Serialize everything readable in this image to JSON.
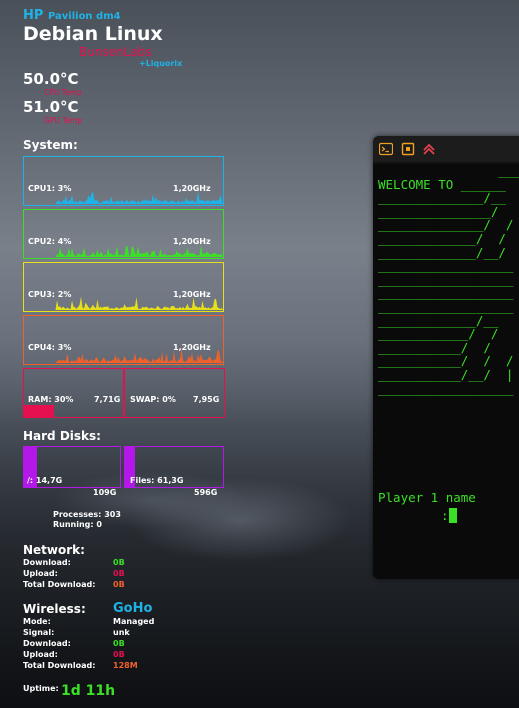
{
  "header": {
    "brand": "HP",
    "model": "Pavilion dm4",
    "os": "Debian Linux",
    "distro": "BunsenLabs",
    "kernel": "+Liquorix"
  },
  "temps": [
    {
      "value": "50.0°C",
      "label": "CPU Temp"
    },
    {
      "value": "51.0°C",
      "label": "GPU Temp"
    }
  ],
  "system": {
    "title": "System:",
    "cpus": [
      {
        "label": "CPU1: 3%",
        "freq": "1,20GHz",
        "color": "#1fb2e6",
        "seed": 1
      },
      {
        "label": "CPU2: 4%",
        "freq": "1,20GHz",
        "color": "#3ae025",
        "seed": 2
      },
      {
        "label": "CPU3: 2%",
        "freq": "1,20GHz",
        "color": "#e6e018",
        "seed": 3
      },
      {
        "label": "CPU4: 3%",
        "freq": "1,20GHz",
        "color": "#f0612a",
        "seed": 4
      }
    ],
    "ram": {
      "label": "RAM: 30%",
      "size": "7,71G",
      "percent": 30
    },
    "swap": {
      "label": "SWAP: 0%",
      "size": "7,95G",
      "percent": 0
    }
  },
  "disks": {
    "title": "Hard Disks:",
    "items": [
      {
        "label": "/: 14,7G",
        "total": "109G",
        "used_fraction": 0.135
      },
      {
        "label": "Files: 61,3G",
        "total": "596G",
        "used_fraction": 0.103
      }
    ]
  },
  "processes": {
    "label": "Processes:",
    "value": "303"
  },
  "running": {
    "label": "Running:",
    "value": "0"
  },
  "network": {
    "title": "Network:",
    "rows": [
      {
        "label": "Download:",
        "value": "0B",
        "color": "green"
      },
      {
        "label": "Upload:",
        "value": "0B",
        "color": "red"
      },
      {
        "label": "Total Download:",
        "value": "0B",
        "color": "orange"
      }
    ]
  },
  "wireless": {
    "title": "Wireless:",
    "ssid": "GoHo",
    "rows": [
      {
        "label": "Mode:",
        "value": "Managed",
        "color": "white"
      },
      {
        "label": "Signal:",
        "value": "unk",
        "color": "white"
      },
      {
        "label": "Download:",
        "value": "0B",
        "color": "green"
      },
      {
        "label": "Upload:",
        "value": "0B",
        "color": "red"
      },
      {
        "label": "Total Download:",
        "value": "128M",
        "color": "orange"
      }
    ]
  },
  "uptime": {
    "label": "Uptime:",
    "value": "1d 11h"
  },
  "terminal": {
    "icons": [
      "terminal-icon",
      "pin-icon",
      "roll-up-icon"
    ],
    "welcome": "WELCOME TO",
    "prompt_label": "Player 1 name",
    "prompt_colon": ":"
  }
}
